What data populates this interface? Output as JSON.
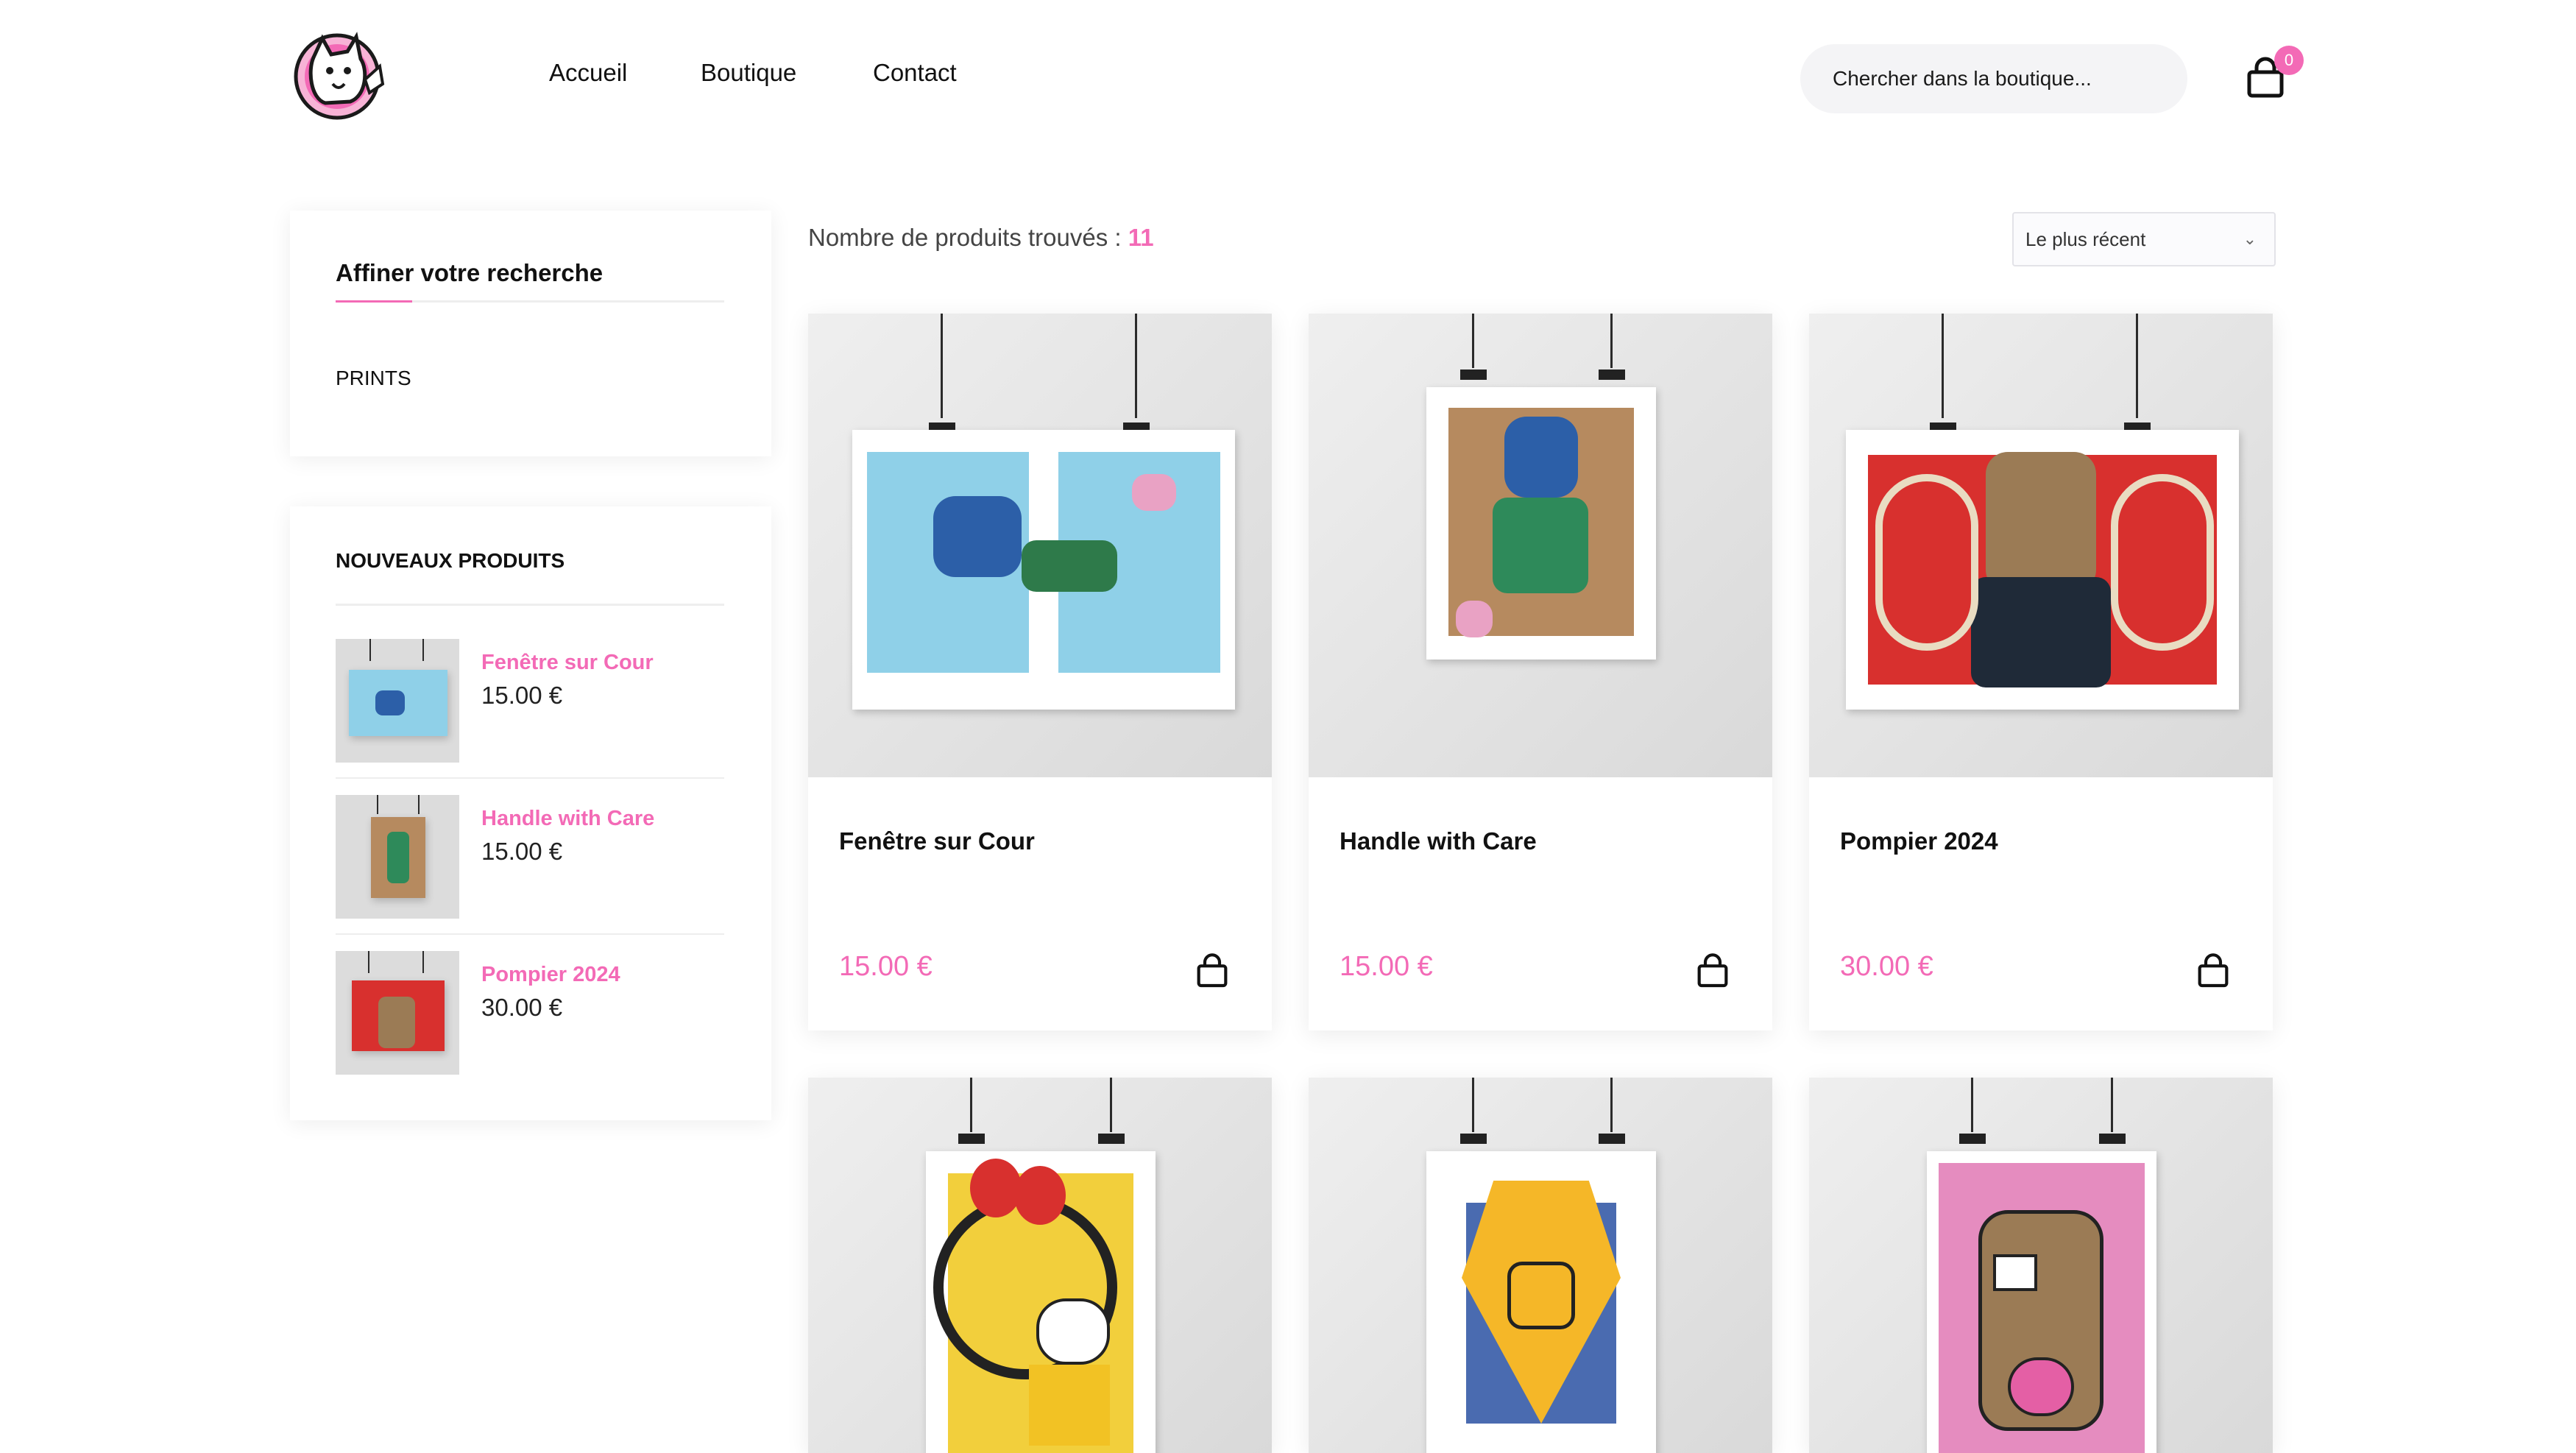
{
  "header": {
    "logo_icon": "dog-mascot-logo",
    "nav": [
      {
        "label": "Accueil"
      },
      {
        "label": "Boutique"
      },
      {
        "label": "Contact"
      }
    ],
    "search_placeholder": "Chercher dans la boutique...",
    "cart_icon": "shopping-bag-icon",
    "cart_count": "0"
  },
  "sidebar": {
    "filter_title": "Affiner votre recherche",
    "categories": [
      {
        "label": "PRINTS"
      }
    ],
    "new_products_title": "NOUVEAUX PRODUITS",
    "new_products": [
      {
        "name": "Fenêtre sur Cour",
        "price": "15.00 €"
      },
      {
        "name": "Handle with Care",
        "price": "15.00 €"
      },
      {
        "name": "Pompier 2024",
        "price": "30.00 €"
      }
    ]
  },
  "main": {
    "count_label": "Nombre de produits trouvés :",
    "count_value": "11",
    "sort_selected": "Le plus récent",
    "products": [
      {
        "name": "Fenêtre sur Cour",
        "price": "15.00 €"
      },
      {
        "name": "Handle with Care",
        "price": "15.00 €"
      },
      {
        "name": "Pompier 2024",
        "price": "30.00 €"
      },
      {
        "name": "",
        "price": ""
      },
      {
        "name": "",
        "price": ""
      },
      {
        "name": "",
        "price": ""
      }
    ]
  },
  "colors": {
    "accent": "#f36ab6",
    "text": "#111111",
    "panel_bg": "#ffffff"
  }
}
